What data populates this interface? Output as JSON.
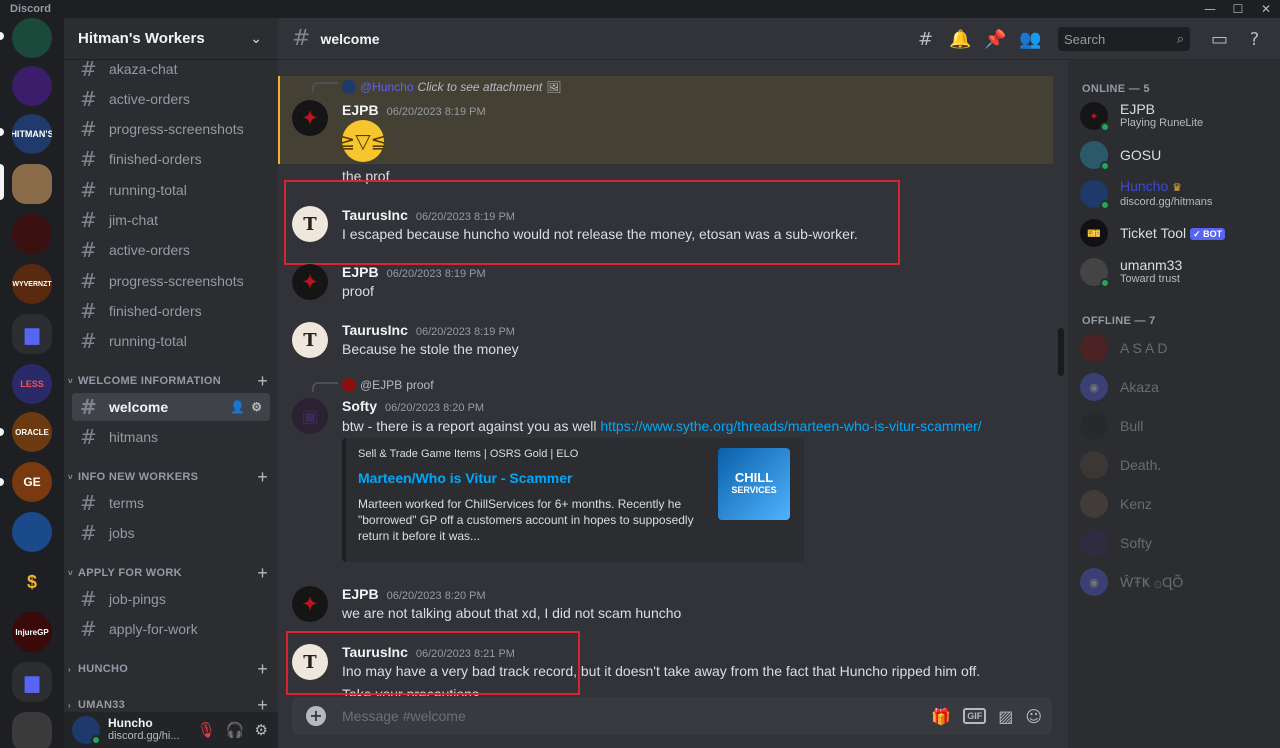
{
  "window": {
    "app_title": "Discord",
    "controls": [
      "—",
      "☐",
      "✕"
    ]
  },
  "server": {
    "name": "Hitman's Workers",
    "channels": [
      {
        "name": "akaza-chat"
      },
      {
        "name": "active-orders"
      },
      {
        "name": "progress-screenshots"
      },
      {
        "name": "finished-orders"
      },
      {
        "name": "running-total"
      },
      {
        "name": "jim-chat"
      },
      {
        "name": "active-orders"
      },
      {
        "name": "progress-screenshots"
      },
      {
        "name": "finished-orders"
      },
      {
        "name": "running-total"
      }
    ],
    "categories": [
      {
        "label": "WELCOME INFORMATION",
        "channels": [
          "welcome",
          "hitmans"
        ]
      },
      {
        "label": "INFO NEW WORKERS",
        "channels": [
          "terms",
          "jobs"
        ]
      },
      {
        "label": "APPLY FOR WORK",
        "channels": [
          "job-pings",
          "apply-for-work"
        ]
      },
      {
        "label": "HUNCHO"
      },
      {
        "label": "UMAN33"
      }
    ]
  },
  "user_panel": {
    "username": "Huncho",
    "status": "discord.gg/hi..."
  },
  "header": {
    "channel": "welcome",
    "search_placeholder": "Search"
  },
  "messages": [
    {
      "reply_mention": "@Huncho",
      "reply_text": "Click to see attachment",
      "author": "EJPB",
      "time": "06/20/2023 8:19 PM",
      "text": "the prof"
    },
    {
      "author": "TaurusInc",
      "time": "06/20/2023 8:19 PM",
      "text": "I escaped because huncho would not release the money, etosan was a sub-worker."
    },
    {
      "author": "EJPB",
      "time": "06/20/2023 8:19 PM",
      "text": "proof"
    },
    {
      "author": "TaurusInc",
      "time": "06/20/2023 8:19 PM",
      "text": "Because he stole the money"
    },
    {
      "reply_mention": "@EJPB",
      "reply_text": "proof",
      "author": "Softy",
      "time": "06/20/2023 8:20 PM",
      "text": "btw - there is a report against you as well ",
      "link": "https://www.sythe.org/threads/marteen-who-is-vitur-scammer/",
      "embed": {
        "provider": "Sell & Trade Game Items | OSRS Gold | ELO",
        "title": "Marteen/Who is Vitur - Scammer",
        "description": "Marteen worked for ChillServices for 6+ months. Recently he \"borrowed\" GP off a customers account in hopes to supposedly return it before it was...",
        "thumb_line1": "CHILL",
        "thumb_line2": "SERVICES"
      }
    },
    {
      "author": "EJPB",
      "time": "06/20/2023 8:20 PM",
      "text": "we are not talking about that xd, I did not scam huncho"
    },
    {
      "author": "TaurusInc",
      "time": "06/20/2023 8:21 PM",
      "text": "Ino may have a very bad track record, but it doesn't take away from the fact that Huncho ripped him off.",
      "text2": "Take your precautions"
    }
  ],
  "composer": {
    "placeholder": "Message #welcome",
    "gif_label": "GIF"
  },
  "members": {
    "online_label": "ONLINE — 5",
    "offline_label": "OFFLINE — 7",
    "online": [
      {
        "name": "EJPB",
        "status": "Playing RuneLite"
      },
      {
        "name": "GOSU",
        "status": ""
      },
      {
        "name": "Huncho",
        "status": "discord.gg/hitmans"
      },
      {
        "name": "Ticket Tool",
        "badge": "✓ BOT"
      },
      {
        "name": "umanm33",
        "status": "Toward trust"
      }
    ],
    "offline": [
      {
        "name": "A S A D"
      },
      {
        "name": "Akaza"
      },
      {
        "name": "Bull"
      },
      {
        "name": "Death."
      },
      {
        "name": "Kenz"
      },
      {
        "name": "Softy"
      },
      {
        "name": "ŴŦҜ ۞ɊÕ"
      }
    ]
  },
  "server_rail": [
    {
      "label": "",
      "color": "#1b4a3a"
    },
    {
      "label": "",
      "color": "#3b1d6b"
    },
    {
      "label": "HITMAN'S",
      "color": "#1f3a6b"
    },
    {
      "label": "",
      "color": "#8a6b4a"
    },
    {
      "label": "",
      "color": "#3a1010"
    },
    {
      "label": "WYVERNZT",
      "color": "#5a2a10"
    },
    {
      "label": "",
      "color": "#2b2d31"
    },
    {
      "label": "LESS",
      "color": "#2a2a6a"
    },
    {
      "label": "ORACLE",
      "color": "#6b3a10"
    },
    {
      "label": "GE",
      "color": "#7a3a10"
    },
    {
      "label": "",
      "color": "#1a4a8a"
    },
    {
      "label": "$",
      "color": "#1e1f22"
    },
    {
      "label": "InjureGP",
      "color": "#3a0a0a"
    },
    {
      "label": "",
      "color": "#2b2d31"
    },
    {
      "label": "",
      "color": "#3a3a3a"
    }
  ]
}
